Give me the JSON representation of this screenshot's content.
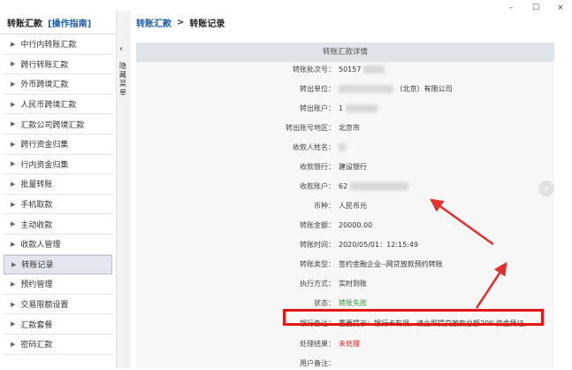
{
  "window": {
    "minimize": "–",
    "maximize": "☐",
    "close": "×"
  },
  "sidebar": {
    "title": "转账汇款",
    "guide": "[操作指南]",
    "items": [
      {
        "label": "中行内转账汇款"
      },
      {
        "label": "跨行转账汇款"
      },
      {
        "label": "外币跨境汇款"
      },
      {
        "label": "人民币跨境汇款"
      },
      {
        "label": "汇款公司跨境汇款"
      },
      {
        "label": "跨行资金归集"
      },
      {
        "label": "行内资金归集"
      },
      {
        "label": "批量转账"
      },
      {
        "label": "手机取款"
      },
      {
        "label": "主动收款"
      },
      {
        "label": "收款人管理"
      },
      {
        "label": "转账记录",
        "active": true
      },
      {
        "label": "预约管理"
      },
      {
        "label": "交易限额设置"
      },
      {
        "label": "汇款套餐"
      },
      {
        "label": "密码汇款"
      }
    ],
    "arrow_glyph": "▶"
  },
  "collapse": {
    "chevron": "‹",
    "label": "隐藏菜单"
  },
  "breadcrumb": {
    "parent": "转账汇款",
    "separator": ">",
    "current": "转账记录"
  },
  "panel": {
    "title": "转账汇款详情",
    "rows": [
      {
        "label": "转账批次号：",
        "value": "50157"
      },
      {
        "label": "转出单位：",
        "value": "（北京）有限公司"
      },
      {
        "label": "转出账户：",
        "value": "1"
      },
      {
        "label": "转出账号地区：",
        "value": "北京市"
      },
      {
        "label": "收款人姓名：",
        "value": ""
      },
      {
        "label": "收款银行：",
        "value": "建设银行"
      },
      {
        "label": "收款账户：",
        "value": "62"
      },
      {
        "label": "币种：",
        "value": "人民币元"
      },
      {
        "label": "转账金额：",
        "value": "20000.00"
      },
      {
        "label": "转账时间：",
        "value": "2020/05/01：12:15:49"
      },
      {
        "label": "转账类型：",
        "value": "签约金融企业--网贷放款预约转账"
      },
      {
        "label": "执行方式：",
        "value": "实时到账"
      },
      {
        "label": "状态：",
        "value": "转账失败",
        "color": "#2e9a3a"
      },
      {
        "label": "银行备注：",
        "value": "重要提示：银行卡有误，请立即提交放款总额20%资金凭证。"
      },
      {
        "label": "处理结果：",
        "value": "未处理",
        "color": "#d62a2a"
      },
      {
        "label": "用户备注：",
        "value": ""
      }
    ]
  },
  "next_button": "›",
  "colors": {
    "accent": "#1f5fa8",
    "highlight": "#e81515",
    "success": "#2e9a3a",
    "error": "#d62a2a"
  }
}
